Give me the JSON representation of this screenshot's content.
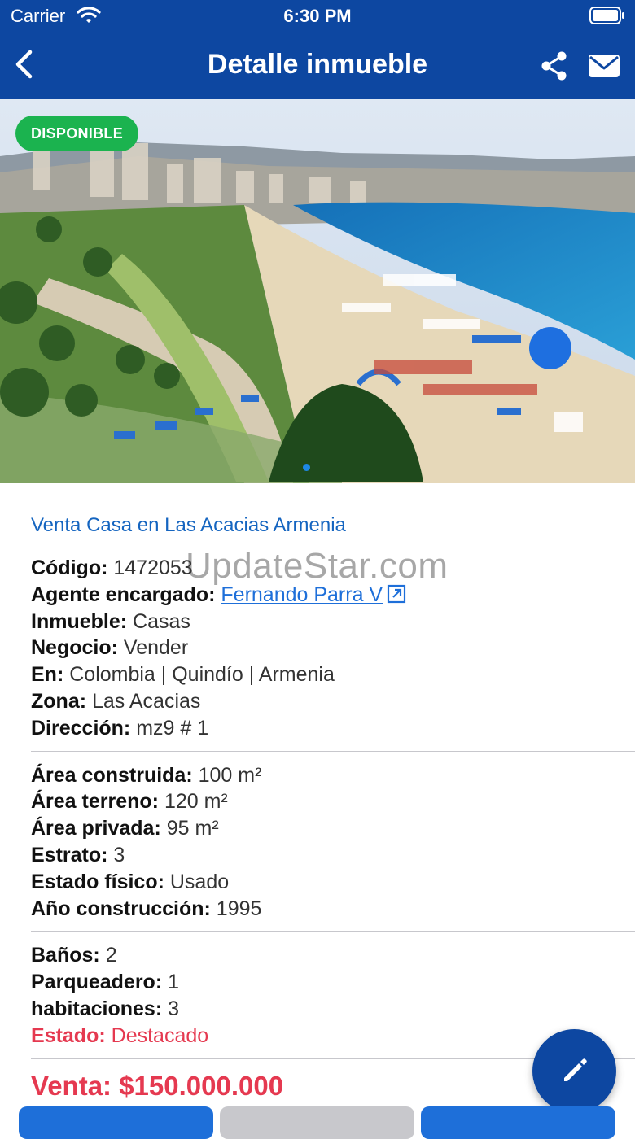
{
  "status_bar": {
    "carrier": "Carrier",
    "time": "6:30 PM"
  },
  "nav": {
    "title": "Detalle inmueble"
  },
  "hero": {
    "badge": "DISPONIBLE"
  },
  "listing": {
    "title": "Venta Casa en Las Acacias Armenia",
    "codigo_label": "Código:",
    "codigo": "1472053",
    "agente_label": "Agente encargado:",
    "agente": "Fernando Parra V",
    "inmueble_label": "Inmueble:",
    "inmueble": "Casas",
    "negocio_label": "Negocio:",
    "negocio": "Vender",
    "en_label": "En:",
    "en": "Colombia | Quindío | Armenia",
    "zona_label": "Zona:",
    "zona": "Las Acacias",
    "direccion_label": "Dirección:",
    "direccion": "mz9 # 1",
    "area_construida_label": "Área construida:",
    "area_construida": "100 m²",
    "area_terreno_label": "Área terreno:",
    "area_terreno": "120 m²",
    "area_privada_label": "Área privada:",
    "area_privada": "95 m²",
    "estrato_label": "Estrato:",
    "estrato": "3",
    "estado_fisico_label": "Estado físico:",
    "estado_fisico": "Usado",
    "anio_label": "Año construcción:",
    "anio": "1995",
    "banos_label": "Baños:",
    "banos": "2",
    "parqueadero_label": "Parqueadero:",
    "parqueadero": "1",
    "habitaciones_label": "habitaciones:",
    "habitaciones": "3",
    "estado_label": "Estado:",
    "estado": "Destacado",
    "price": "Venta: $150.000.000"
  },
  "watermark": "UpdateStar.com",
  "colors": {
    "primary": "#0d47a1",
    "link": "#1565c0",
    "available": "#1bb34f",
    "accent_red": "#e53950"
  }
}
